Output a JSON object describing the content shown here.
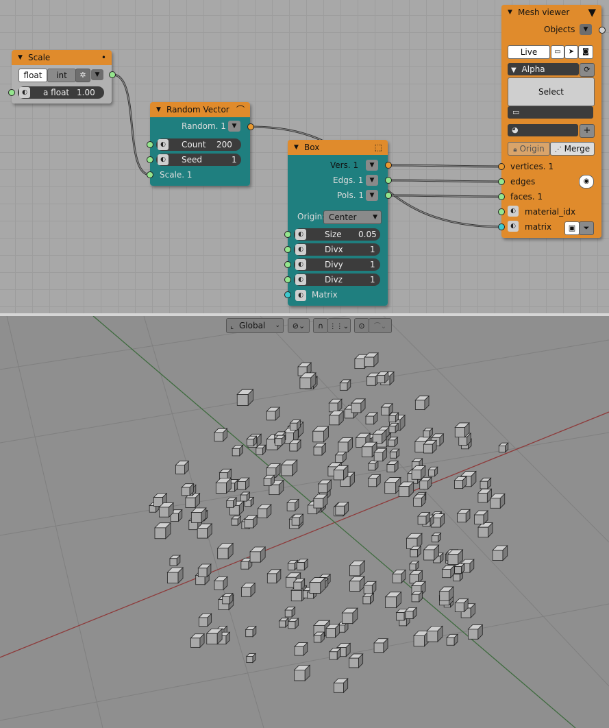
{
  "nodes": {
    "scale": {
      "title": "Scale",
      "dot": "•",
      "mode_float": "float",
      "mode_int": "int",
      "field_label": "a float",
      "field_value": "1.00"
    },
    "random_vector": {
      "title": "Random Vector",
      "output_label": "Random. 1",
      "count_label": "Count",
      "count_value": "200",
      "seed_label": "Seed",
      "seed_value": "1",
      "scale_label": "Scale. 1"
    },
    "box": {
      "title": "Box",
      "out_vers": "Vers. 1",
      "out_edgs": "Edgs. 1",
      "out_pols": "Pols. 1",
      "origin_label": "Origin:",
      "origin_value": "Center",
      "size_label": "Size",
      "size_value": "0.05",
      "divx_label": "Divx",
      "divx_value": "1",
      "divy_label": "Divy",
      "divy_value": "1",
      "divz_label": "Divz",
      "divz_value": "1",
      "matrix_label": "Matrix"
    },
    "mesh_viewer": {
      "title": "Mesh viewer",
      "objects_label": "Objects",
      "live_label": "Live",
      "alpha_label": "Alpha",
      "select_label": "Select",
      "origin_label": "Origin",
      "merge_label": "Merge",
      "in_vertices": "vertices. 1",
      "in_edges": "edges",
      "in_faces": "faces. 1",
      "in_material": "material_idx",
      "in_matrix": "matrix"
    }
  },
  "viewport_header": {
    "orientation_value": "Global"
  },
  "colors": {
    "node_header": "#e08b2c",
    "node_teal": "#1f7f7f",
    "socket_vertices": "#e99a32",
    "socket_float": "#95e68e",
    "socket_matrix": "#3ec9cf",
    "x_axis": "#8e3a3a",
    "y_axis": "#3e6b3e"
  }
}
